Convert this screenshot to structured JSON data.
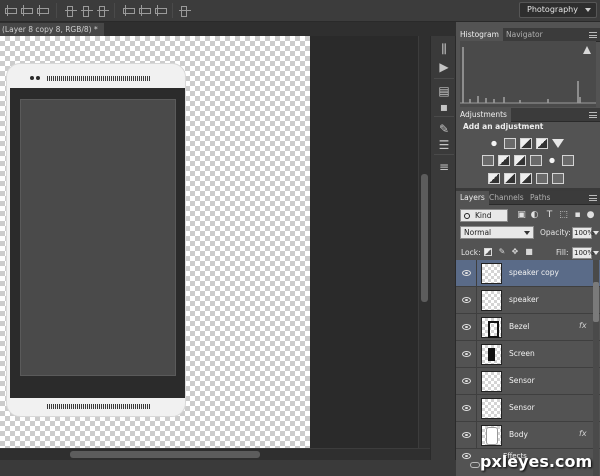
{
  "workspace": {
    "label": "Photography"
  },
  "document": {
    "tab_title": "(Layer 8 copy 8, RGB/8) *"
  },
  "histogram_panel": {
    "tabs": [
      "Histogram",
      "Navigator"
    ],
    "active_tab": "Histogram",
    "warning_icon": "cache-warning-icon"
  },
  "adjustments_panel": {
    "tab": "Adjustments",
    "title": "Add an adjustment",
    "row1_icons": [
      "brightness-contrast-icon",
      "levels-icon",
      "curves-icon",
      "exposure-icon",
      "vibrance-icon"
    ],
    "row2_icons": [
      "hue-saturation-icon",
      "color-balance-icon",
      "black-white-icon",
      "photo-filter-icon",
      "channel-mixer-icon",
      "color-lookup-icon"
    ],
    "row3_icons": [
      "invert-icon",
      "posterize-icon",
      "threshold-icon",
      "gradient-map-icon",
      "selective-color-icon"
    ]
  },
  "layers_panel": {
    "tabs": [
      "Layers",
      "Channels",
      "Paths"
    ],
    "active_tab": "Layers",
    "kind_label": "Kind",
    "blend_mode": "Normal",
    "opacity_label": "Opacity:",
    "opacity_value": "100%",
    "lock_label": "Lock:",
    "fill_label": "Fill:",
    "fill_value": "100%",
    "layers": [
      {
        "name": "speaker copy",
        "selected": true,
        "fx": false,
        "thumb": "checker"
      },
      {
        "name": "speaker",
        "selected": false,
        "fx": false,
        "thumb": "checker"
      },
      {
        "name": "Bezel",
        "selected": false,
        "fx": true,
        "thumb": "bezel"
      },
      {
        "name": "Screen",
        "selected": false,
        "fx": false,
        "thumb": "screen"
      },
      {
        "name": "Sensor",
        "selected": false,
        "fx": false,
        "thumb": "checker"
      },
      {
        "name": "Sensor",
        "selected": false,
        "fx": false,
        "thumb": "checker"
      },
      {
        "name": "Body",
        "selected": false,
        "fx": true,
        "thumb": "body"
      }
    ],
    "effects_label": "Effects",
    "fx_symbol": "fx"
  },
  "watermark": {
    "text": "pxleyes.com"
  },
  "colors": {
    "selected_row": "#5a6b88",
    "panel_bg": "#535353",
    "canvas_bg": "#2a2a2a"
  }
}
